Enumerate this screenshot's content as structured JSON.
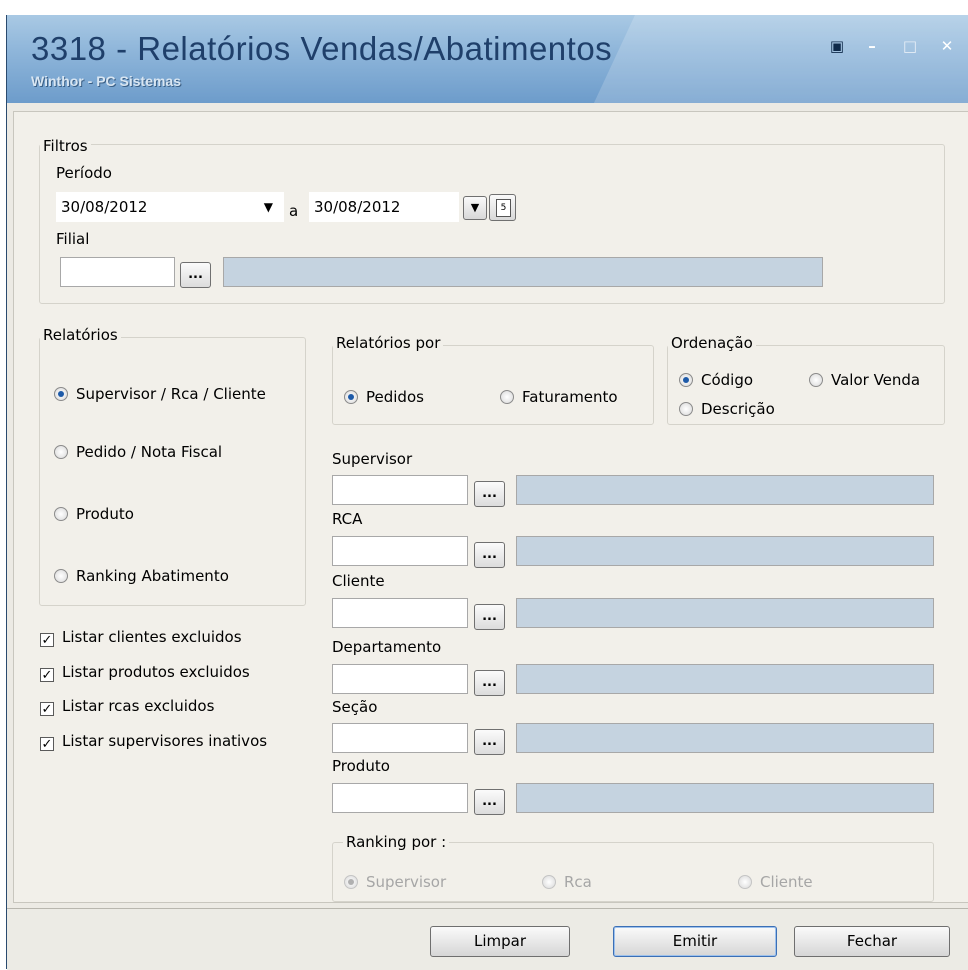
{
  "window": {
    "title": "3318 - Relatórios Vendas/Abatimentos",
    "subtitle": "Winthor - PC Sistemas",
    "controls": {
      "restore": "▣",
      "minimize": "–",
      "maximize": "□",
      "close": "✕"
    }
  },
  "filtros": {
    "group_label": "Filtros",
    "periodo_label": "Período",
    "date_from": "30/08/2012",
    "date_sep": "a",
    "date_to": "30/08/2012",
    "filial_label": "Filial",
    "filial_value": ""
  },
  "relatorios": {
    "group_label": "Relatórios",
    "options": [
      {
        "label": "Supervisor / Rca / Cliente",
        "selected": true
      },
      {
        "label": "Pedido / Nota Fiscal",
        "selected": false
      },
      {
        "label": "Produto",
        "selected": false
      },
      {
        "label": "Ranking Abatimento",
        "selected": false
      }
    ]
  },
  "relatorios_por": {
    "group_label": "Relatórios por",
    "options": [
      {
        "label": "Pedidos",
        "selected": true
      },
      {
        "label": "Faturamento",
        "selected": false
      }
    ]
  },
  "ordenacao": {
    "group_label": "Ordenação",
    "options": [
      {
        "label": "Código",
        "selected": true
      },
      {
        "label": "Valor Venda",
        "selected": false
      },
      {
        "label": "Descrição",
        "selected": false
      }
    ]
  },
  "checkboxes": [
    {
      "label": "Listar clientes excluidos",
      "checked": true
    },
    {
      "label": "Listar produtos excluidos",
      "checked": true
    },
    {
      "label": "Listar rcas excluidos",
      "checked": true
    },
    {
      "label": "Listar supervisores inativos",
      "checked": true
    }
  ],
  "lookups": [
    {
      "label": "Supervisor"
    },
    {
      "label": "RCA"
    },
    {
      "label": "Cliente"
    },
    {
      "label": "Departamento"
    },
    {
      "label": "Seção"
    },
    {
      "label": "Produto"
    }
  ],
  "ellipsis": "...",
  "ranking": {
    "group_label": "Ranking por :",
    "options": [
      {
        "label": "Supervisor",
        "selected": true
      },
      {
        "label": "Rca",
        "selected": false
      },
      {
        "label": "Cliente",
        "selected": false
      }
    ]
  },
  "buttons": {
    "limpar": "Limpar",
    "emitir": "Emitir",
    "fechar": "Fechar"
  },
  "colors": {
    "titlebar": "#8fb6da",
    "title_text": "#1f3f6a",
    "desc_field": "#c5d3e0",
    "window_bg": "#f2f0ea"
  }
}
